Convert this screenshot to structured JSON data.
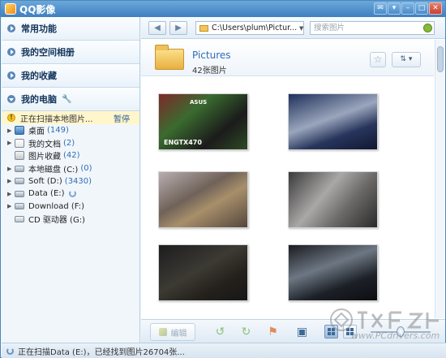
{
  "app": {
    "title": "QQ影像",
    "window_buttons": [
      "chat-icon",
      "skin-icon",
      "minimize-icon",
      "maximize-icon",
      "close-icon"
    ]
  },
  "sidebar": {
    "sections": [
      {
        "label": "常用功能"
      },
      {
        "label": "我的空间相册"
      },
      {
        "label": "我的收藏"
      },
      {
        "label": "我的电脑"
      }
    ],
    "scan_text": "正在扫描本地图片...",
    "pause_label": "暂停",
    "tree": [
      {
        "label": "桌面",
        "count": "(149)",
        "icon": "desktop-icon",
        "expandable": true
      },
      {
        "label": "我的文档",
        "count": "(2)",
        "icon": "documents-icon",
        "expandable": true
      },
      {
        "label": "图片收藏",
        "count": "(42)",
        "icon": "pictures-icon",
        "expandable": false
      },
      {
        "label": "本地磁盘 (C:)",
        "count": "(0)",
        "icon": "disk-icon",
        "expandable": true
      },
      {
        "label": "Soft (D:)",
        "count": "(3430)",
        "icon": "disk-icon",
        "expandable": true
      },
      {
        "label": "Data (E:)",
        "count": "",
        "icon": "disk-icon",
        "expandable": true,
        "loading": true
      },
      {
        "label": "Download (F:)",
        "count": "",
        "icon": "disk-icon",
        "expandable": true
      },
      {
        "label": "CD 驱动器 (G:)",
        "count": "",
        "icon": "cd-drive-icon",
        "expandable": false
      }
    ]
  },
  "toolbar": {
    "back_icon": "back-arrow-icon",
    "forward_icon": "forward-arrow-icon",
    "path": "C:\\Users\\plum\\Pictur...",
    "search_placeholder": "搜索图片"
  },
  "folder": {
    "name": "Pictures",
    "count_text": "42张图片"
  },
  "thumbnails": [
    {
      "caption": "ENGTX470",
      "logo": "ASUS"
    },
    {
      "caption": "",
      "logo": ""
    },
    {
      "caption": "",
      "logo": ""
    },
    {
      "caption": "",
      "logo": ""
    },
    {
      "caption": "",
      "logo": ""
    },
    {
      "caption": "",
      "logo": ""
    }
  ],
  "bottom": {
    "edit_label": "编辑",
    "zoom_level": 0.5
  },
  "status": {
    "text": "正在扫描Data (E:)，已经找到图片26704张..."
  },
  "watermark": {
    "sub": "www.PCdrivers.com"
  },
  "colors": {
    "accent": "#3f7fbe",
    "link": "#2f6db5",
    "scan_bg": "#fff6cc"
  }
}
